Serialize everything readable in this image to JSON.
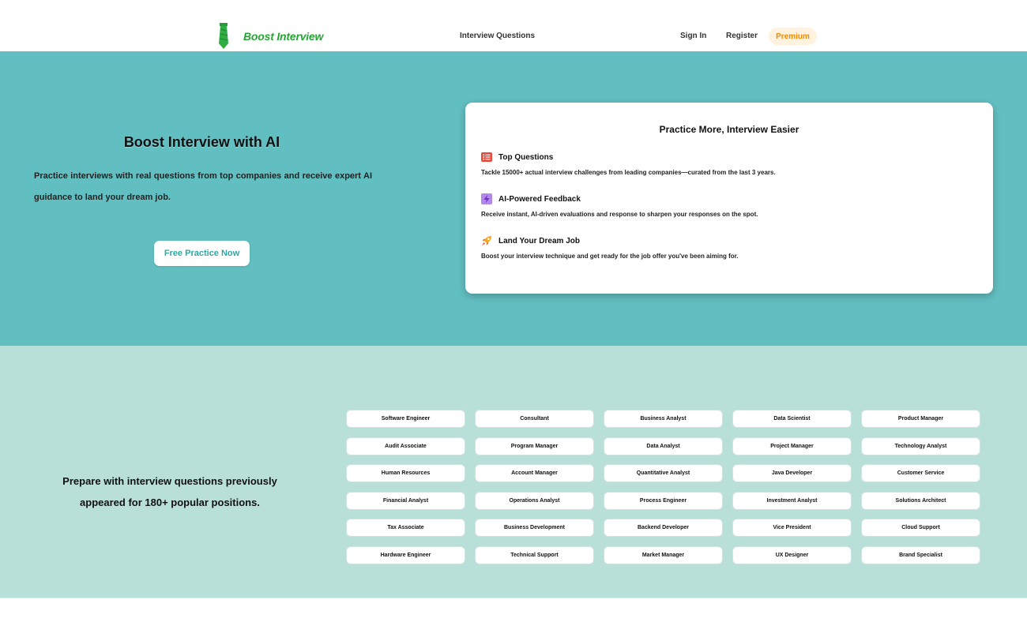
{
  "header": {
    "brand": "Boost Interview",
    "nav_interview_questions": "Interview Questions",
    "sign_in": "Sign In",
    "register": "Register",
    "premium": "Premium"
  },
  "hero": {
    "title": "Boost Interview with AI",
    "subtitle": "Practice interviews with real questions from top companies and receive expert AI guidance to land your dream job.",
    "cta": "Free Practice Now"
  },
  "features_card": {
    "title": "Practice More, Interview Easier",
    "items": [
      {
        "icon": "list-icon",
        "name": "Top Questions",
        "desc": "Tackle 15000+ actual interview challenges from leading companies—curated from the last 3 years."
      },
      {
        "icon": "lightning-icon",
        "name": "AI-Powered Feedback",
        "desc": "Receive instant, AI-driven evaluations and response to sharpen your responses on the spot."
      },
      {
        "icon": "rocket-icon",
        "name": "Land Your Dream Job",
        "desc": "Boost your interview technique and get ready for the job offer you've been aiming for."
      }
    ]
  },
  "positions": {
    "heading": "Prepare with interview questions previously appeared for 180+ popular positions.",
    "items": [
      "Software Engineer",
      "Consultant",
      "Business Analyst",
      "Data Scientist",
      "Product Manager",
      "Audit Associate",
      "Program Manager",
      "Data Analyst",
      "Project Manager",
      "Technology Analyst",
      "Human Resources",
      "Account Manager",
      "Quantitative Analyst",
      "Java Developer",
      "Customer Service",
      "Financial Analyst",
      "Operations Analyst",
      "Process Engineer",
      "Investment Analyst",
      "Solutions Architect",
      "Tax Associate",
      "Business Development",
      "Backend Developer",
      "Vice President",
      "Cloud Support",
      "Hardware Engineer",
      "Technical Support",
      "Market Manager",
      "UX Designer",
      "Brand Specialist"
    ]
  },
  "colors": {
    "brand_green": "#26a536",
    "hero_teal": "#62bfc1",
    "positions_mint": "#b9e0d8",
    "premium_orange": "#f08a00"
  }
}
